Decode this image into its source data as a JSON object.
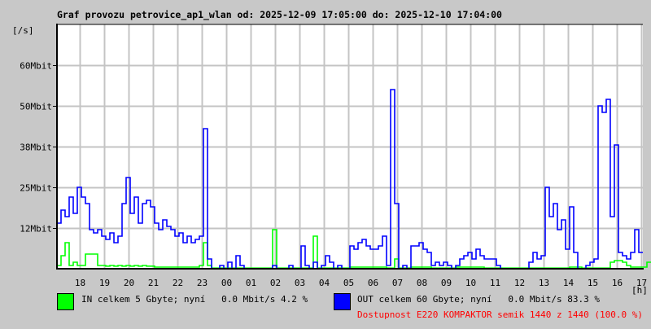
{
  "chart_data": {
    "type": "line",
    "title": "Graf provozu petrovice_ap1_wlan od: 2025-12-09 17:05:00 do: 2025-12-10 17:04:00",
    "ylabel": "[/s]",
    "xlabel": "[h]",
    "ylim_mbit": [
      0,
      75
    ],
    "y_ticks": [
      {
        "value": 12.5,
        "label": "12Mbit"
      },
      {
        "value": 25,
        "label": "25Mbit"
      },
      {
        "value": 37.5,
        "label": "38Mbit"
      },
      {
        "value": 50,
        "label": "50Mbit"
      },
      {
        "value": 62.5,
        "label": "60Mbit"
      }
    ],
    "x_range_hours": [
      0,
      24
    ],
    "x_ticks": [
      {
        "h": 0.9167,
        "label": "18"
      },
      {
        "h": 1.9167,
        "label": "19"
      },
      {
        "h": 2.9167,
        "label": "20"
      },
      {
        "h": 3.9167,
        "label": "21"
      },
      {
        "h": 4.9167,
        "label": "22"
      },
      {
        "h": 5.9167,
        "label": "23"
      },
      {
        "h": 6.9167,
        "label": "00"
      },
      {
        "h": 7.9167,
        "label": "01"
      },
      {
        "h": 8.9167,
        "label": "02"
      },
      {
        "h": 9.9167,
        "label": "03"
      },
      {
        "h": 10.9167,
        "label": "04"
      },
      {
        "h": 11.9167,
        "label": "05"
      },
      {
        "h": 12.9167,
        "label": "06"
      },
      {
        "h": 13.9167,
        "label": "07"
      },
      {
        "h": 14.9167,
        "label": "08"
      },
      {
        "h": 15.9167,
        "label": "09"
      },
      {
        "h": 16.9167,
        "label": "10"
      },
      {
        "h": 17.9167,
        "label": "11"
      },
      {
        "h": 18.9167,
        "label": "12"
      },
      {
        "h": 19.9167,
        "label": "13"
      },
      {
        "h": 20.9167,
        "label": "14"
      },
      {
        "h": 21.9167,
        "label": "15"
      },
      {
        "h": 22.9167,
        "label": "16"
      },
      {
        "h": 23.9167,
        "label": "17"
      }
    ],
    "interval_minutes": 10,
    "grid": true,
    "series": [
      {
        "name": "IN",
        "color": "#00ff00",
        "values": [
          1,
          4,
          8,
          1,
          2,
          1,
          1,
          4.5,
          4.5,
          4.5,
          1,
          1,
          0.8,
          1,
          0.8,
          1,
          0.8,
          1,
          0.8,
          1,
          0.8,
          1,
          0.8,
          0.8,
          0.5,
          0.5,
          0.5,
          0.5,
          0.5,
          0.5,
          0.5,
          0.5,
          0.5,
          0.5,
          0.5,
          1,
          8,
          1,
          0.2,
          0.2,
          0.2,
          0.2,
          0.2,
          0.2,
          0.2,
          0.2,
          0.2,
          0.2,
          0.2,
          0.2,
          0.2,
          0.2,
          0.2,
          12,
          0.2,
          0.2,
          0.2,
          0.2,
          0.2,
          0.2,
          0.2,
          0.2,
          0.2,
          10,
          0.2,
          0.2,
          0.2,
          0.2,
          0.2,
          0.2,
          0.2,
          0.2,
          0.5,
          0.5,
          0.5,
          0.5,
          0.5,
          0.5,
          0.5,
          0.5,
          0.5,
          0.2,
          0.2,
          3,
          0.2,
          0.2,
          0.2,
          0.5,
          0.5,
          0.5,
          0.5,
          0.5,
          0.2,
          0.2,
          0.2,
          0.2,
          0.2,
          0.2,
          0.5,
          0.5,
          0.5,
          0.5,
          0.5,
          0.5,
          0.5,
          0.2,
          0.2,
          0.2,
          0.2,
          0.2,
          0.2,
          0.2,
          0.2,
          0.2,
          0.2,
          0.2,
          0.2,
          0.2,
          0.2,
          0.2,
          0.2,
          0.2,
          0.2,
          0.2,
          0.2,
          0.2,
          0.5,
          0.5,
          0.5,
          0.2,
          0.2,
          0.2,
          0.2,
          0.2,
          0.2,
          0.2,
          2,
          2.5,
          2.5,
          2,
          1,
          0.5,
          0.5,
          0.5,
          0.5,
          2
        ]
      },
      {
        "name": "OUT",
        "color": "#0000ff",
        "values": [
          14,
          18,
          16,
          22,
          17,
          25,
          22,
          20,
          12,
          11,
          12,
          10,
          9,
          11,
          8,
          10,
          20,
          28,
          17,
          22,
          14,
          20,
          21,
          19,
          14,
          12,
          15,
          13,
          12,
          10,
          11,
          8,
          10,
          8,
          9,
          10,
          43,
          3,
          0,
          0,
          1,
          0,
          2,
          0,
          4,
          1,
          0,
          0,
          0,
          0,
          0,
          0,
          0,
          1,
          0,
          0,
          0,
          1,
          0,
          0,
          7,
          1,
          0,
          2,
          0,
          1,
          4,
          2,
          0,
          1,
          0,
          0,
          7,
          6,
          8,
          9,
          7,
          6,
          6,
          7,
          10,
          1,
          55,
          20,
          0,
          1,
          0,
          7,
          7,
          8,
          6,
          5,
          1,
          2,
          1,
          2,
          1,
          0,
          1,
          3,
          4,
          5,
          3,
          6,
          4,
          3,
          3,
          3,
          1,
          0,
          0,
          0,
          0,
          0,
          0,
          0,
          2,
          5,
          3,
          4,
          25,
          16,
          20,
          12,
          15,
          6,
          19,
          5,
          0,
          0,
          1,
          2,
          3,
          50,
          48,
          52,
          16,
          38,
          5,
          4,
          3,
          5,
          12,
          5
        ]
      }
    ]
  },
  "legend": {
    "in_label": "IN celkem 5 Gbyte; nyní   0.0 Mbit/s 4.2 %",
    "out_label": "OUT celkem 60 Gbyte; nyní   0.0 Mbit/s 83.3 %",
    "availability": "Dostupnost E220 KOMPAKTOR semik 1440 z 1440 (100.0 %)",
    "availability_color": "#ff0000"
  }
}
